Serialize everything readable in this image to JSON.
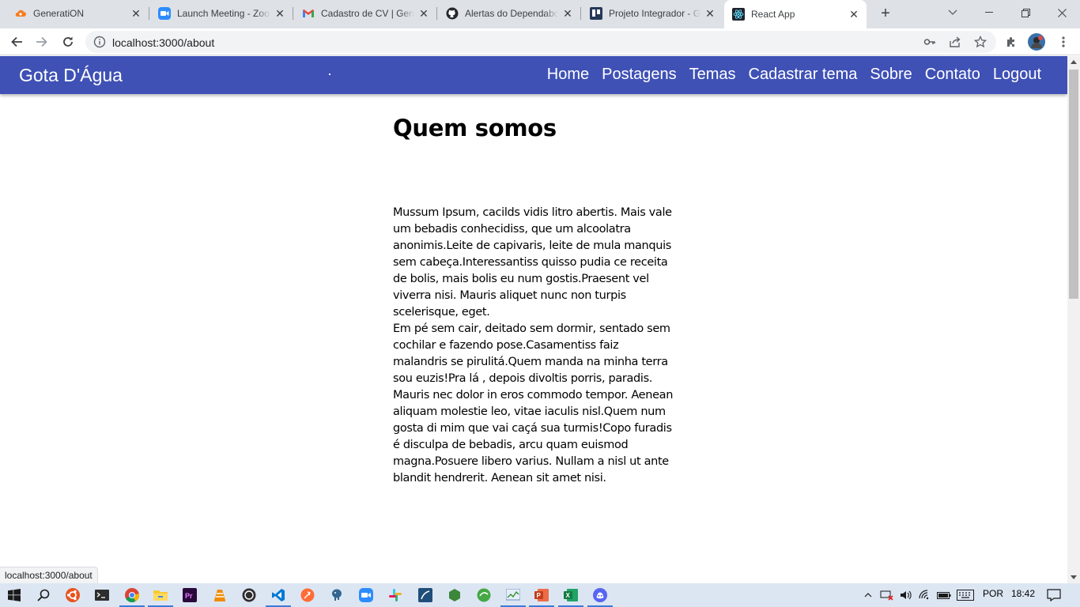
{
  "browser": {
    "tabs": [
      {
        "title": "GeneratiON",
        "favicon": "cloud-icon",
        "active": false
      },
      {
        "title": "Launch Meeting - Zoom",
        "favicon": "zoom-icon",
        "active": false
      },
      {
        "title": "Cadastro de CV | GenT",
        "favicon": "gmail-icon",
        "active": false
      },
      {
        "title": "Alertas do Dependabot",
        "favicon": "github-icon",
        "active": false
      },
      {
        "title": "Projeto Integrador - G",
        "favicon": "trello-icon",
        "active": false
      },
      {
        "title": "React App",
        "favicon": "react-icon",
        "active": true
      }
    ],
    "url": "localhost:3000/about",
    "status_url": "localhost:3000/about"
  },
  "app": {
    "brand": "Gota D'Água",
    "nav": {
      "home": "Home",
      "postagens": "Postagens",
      "temas": "Temas",
      "cadastrar_tema": "Cadastrar tema",
      "sobre": "Sobre",
      "contato": "Contato",
      "logout": "Logout"
    },
    "accent_color": "#3f51b5"
  },
  "content": {
    "title": "Quem somos",
    "body": "Mussum Ipsum, cacilds vidis litro abertis. Mais vale um bebadis conhecidiss, que um alcoolatra anonimis.Leite de capivaris, leite de mula manquis sem cabeça.Interessantiss quisso pudia ce receita de bolis, mais bolis eu num gostis.Praesent vel viverra nisi. Mauris aliquet nunc non turpis scelerisque, eget.\nEm pé sem cair, deitado sem dormir, sentado sem cochilar e fazendo pose.Casamentiss faiz malandris se pirulitá.Quem manda na minha terra sou euzis!Pra lá , depois divoltis porris, paradis. Mauris nec dolor in eros commodo tempor. Aenean aliquam molestie leo, vitae iaculis nisl.Quem num gosta di mim que vai caçá sua turmis!Copo furadis é disculpa de bebadis, arcu quam euismod magna.Posuere libero varius. Nullam a nisl ut ante blandit hendrerit. Aenean sit amet nisi."
  },
  "taskbar": {
    "language": "POR",
    "time": "18:42"
  }
}
